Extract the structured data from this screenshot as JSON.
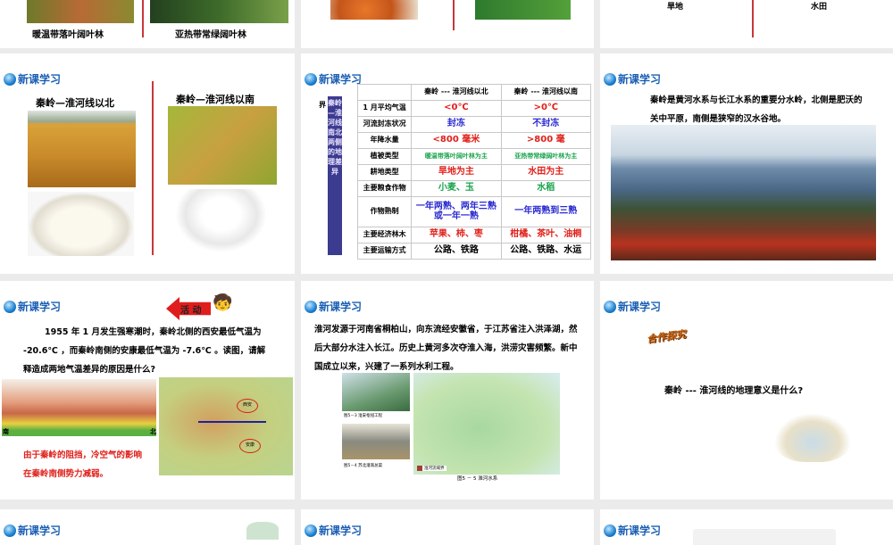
{
  "header_label": "新课学习",
  "slides": {
    "s1": {
      "caption_left": "暖温带落叶阔叶林",
      "caption_right": "亚热带常绿阔叶林"
    },
    "s3": {
      "caption_left": "旱地",
      "caption_right": "水田"
    },
    "s4": {
      "title_north": "秦岭—淮河线以北",
      "title_south": "秦岭—淮河线以南"
    },
    "s5": {
      "side_label": "秦岭—淮河线南北两侧的地理差异",
      "side_prefix": "界",
      "headers": [
        "",
        "秦岭 --- 淮河线以北",
        "秦岭 --- 淮河线以南"
      ],
      "rows": [
        [
          "1 月平均气温",
          "<0℃",
          ">0℃"
        ],
        [
          "河流封冻状况",
          "封冻",
          "不封冻"
        ],
        [
          "年降水量",
          "<800 毫米",
          ">800 毫"
        ],
        [
          "植被类型",
          "暖温带落叶阔叶林为主",
          "亚热带常绿阔叶林为主"
        ],
        [
          "耕地类型",
          "旱地为主",
          "水田为主"
        ],
        [
          "主要粮食作物",
          "小麦、玉",
          "水稻"
        ],
        [
          "作物熟制",
          "一年两熟、两年三熟或一年一熟",
          "一年两熟到三熟"
        ],
        [
          "主要经济林木",
          "苹果、柿、枣",
          "柑橘、茶叶、油桐"
        ],
        [
          "主要运输方式",
          "公路、铁路",
          "公路、铁路、水运"
        ]
      ]
    },
    "s6": {
      "text": "秦岭是黄河水系与长江水系的重要分水岭，北侧是肥沃的关中平原，南侧是狭窄的汉水谷地。"
    },
    "s7": {
      "activity": "活 动",
      "text": "1955 年 1 月发生强寒潮时，秦岭北侧的西安最低气温为 -20.6℃ ，而秦岭南侧的安康最低气温为 -7.6℃ 。读图，请解释造成两地气温差异的原因是什么?",
      "answer": "由于秦岭的阻挡，冷空气的影响在秦岭南侧势力减弱。",
      "profile_north": "北",
      "profile_south": "南",
      "map_labels": [
        "西安",
        "安康"
      ]
    },
    "s8": {
      "text": "淮河发源于河南省桐柏山，向东流经安徽省，于江苏省注入洪泽湖，然后大部分水注入长江。历史上黄河多次夺淮入海，洪涝灾害频繁。新中国成立以来，兴建了一系列水利工程。",
      "fig3": "图5－3  淮安枢纽工程",
      "fig4": "图5－4  苏北灌溉总渠",
      "legend": "淮河流域界",
      "fig5": "图5 － 5 淮河水系"
    },
    "s9": {
      "badge": "合作探究",
      "question": "秦岭 --- 淮河线的地理意义是什么?"
    }
  }
}
